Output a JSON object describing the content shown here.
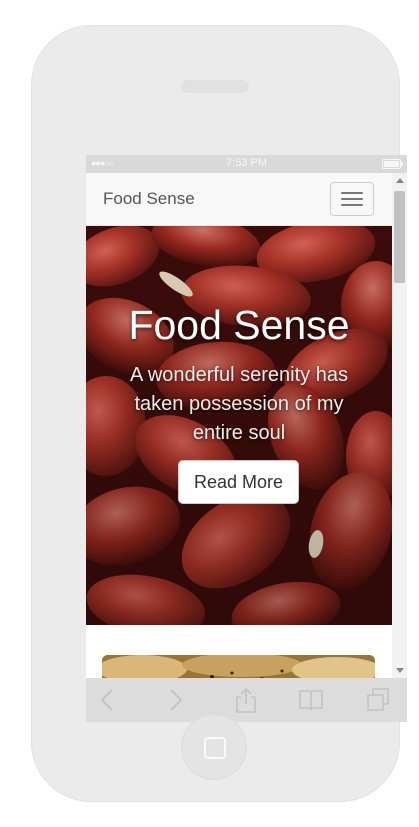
{
  "status_bar": {
    "signal": "●●●○○",
    "time": "7:53 PM"
  },
  "navbar": {
    "brand": "Food Sense"
  },
  "hero": {
    "title": "Food Sense",
    "subtitle": "A wonderful serenity has taken possession of my entire soul",
    "button_label": "Read More"
  },
  "toolbar": {
    "icons": [
      "back-icon",
      "forward-icon",
      "share-icon",
      "bookmarks-icon",
      "tabs-icon"
    ]
  },
  "colors": {
    "frame": "#ebebeb",
    "status_bar": "#d9d9d9",
    "navbar": "#f8f8f8",
    "hero_button": "#ffffff"
  }
}
